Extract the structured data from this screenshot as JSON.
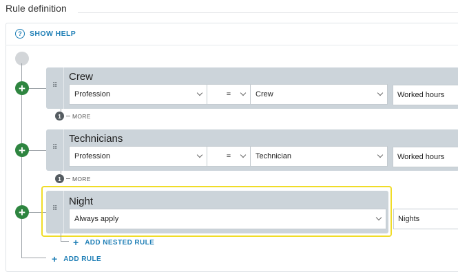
{
  "header": {
    "title": "Rule definition"
  },
  "help": {
    "label": "SHOW HELP",
    "icon": "?"
  },
  "rules": [
    {
      "name": "Crew",
      "field": "Profession",
      "operator": "=",
      "value": "Crew",
      "outcome": "Worked hours",
      "more_count": "1",
      "more_label": "MORE"
    },
    {
      "name": "Technicians",
      "field": "Profession",
      "operator": "=",
      "value": "Technician",
      "outcome": "Worked hours",
      "more_count": "1",
      "more_label": "MORE"
    },
    {
      "name": "Night",
      "field": "Always apply",
      "outcome": "Nights"
    }
  ],
  "actions": {
    "add_nested_rule": "ADD NESTED RULE",
    "add_rule": "ADD RULE"
  },
  "icons": {
    "plus": "+",
    "drag": "⠿"
  },
  "colors": {
    "accent": "#1f7fb6",
    "add_button": "#2e8540",
    "card": "#ccd4da",
    "highlight": "#f0dc27"
  }
}
